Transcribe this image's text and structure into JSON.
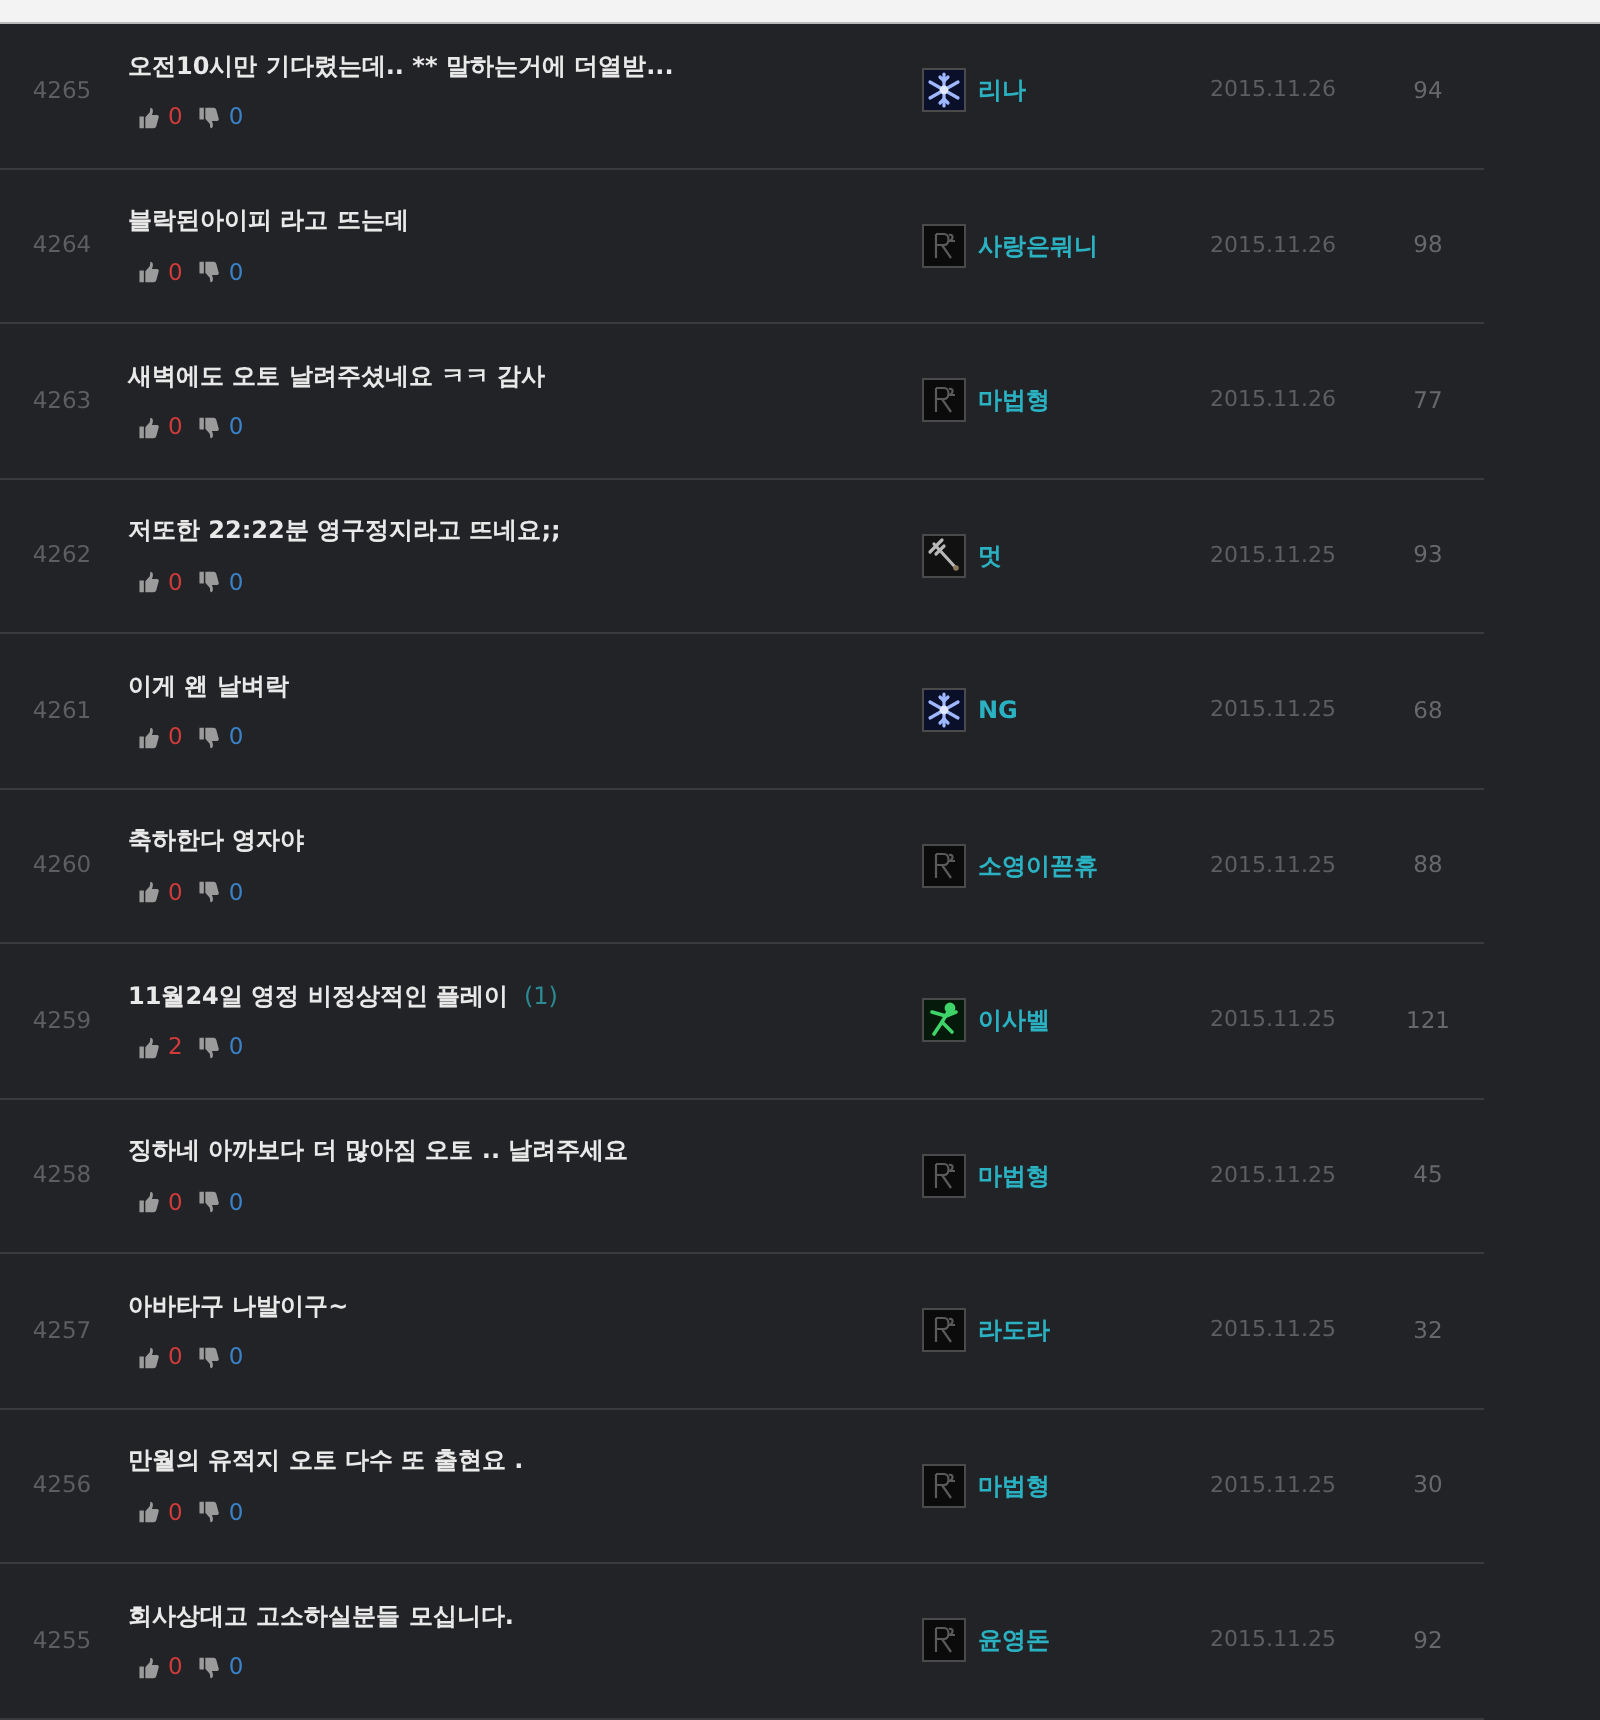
{
  "posts": [
    {
      "number": "4265",
      "title": "오전10시만 기다렸는데.. ** 말하는거에 더열받...",
      "likes": "0",
      "dislikes": "0",
      "avatar": {
        "kind": "snowflake"
      },
      "author": "리나",
      "date": "2015.11.26",
      "views": "94"
    },
    {
      "number": "4264",
      "title": "블락된아이피 라고 뜨는데",
      "likes": "0",
      "dislikes": "0",
      "avatar": {
        "kind": "emblem"
      },
      "author": "사랑은뭐니",
      "date": "2015.11.26",
      "views": "98"
    },
    {
      "number": "4263",
      "title": "새벽에도 오토 날려주셨네요 ㅋㅋ 감사",
      "likes": "0",
      "dislikes": "0",
      "avatar": {
        "kind": "emblem"
      },
      "author": "마법형",
      "date": "2015.11.26",
      "views": "77"
    },
    {
      "number": "4262",
      "title": "저또한 22:22분 영구정지라고 뜨네요;;",
      "likes": "0",
      "dislikes": "0",
      "avatar": {
        "kind": "sword"
      },
      "author": "멋",
      "date": "2015.11.25",
      "views": "93"
    },
    {
      "number": "4261",
      "title": "이게 왠 날벼락",
      "likes": "0",
      "dislikes": "0",
      "avatar": {
        "kind": "snowflake"
      },
      "author": "NG",
      "date": "2015.11.25",
      "views": "68"
    },
    {
      "number": "4260",
      "title": "축하한다 영자야",
      "likes": "0",
      "dislikes": "0",
      "avatar": {
        "kind": "emblem"
      },
      "author": "소영이꼳휴",
      "date": "2015.11.25",
      "views": "88"
    },
    {
      "number": "4259",
      "title": "11월24일 영정 비정상적인 플레이",
      "comment_count": "(1)",
      "likes": "2",
      "dislikes": "0",
      "avatar": {
        "kind": "figure"
      },
      "author": "이사벨",
      "date": "2015.11.25",
      "views": "121"
    },
    {
      "number": "4258",
      "title": "징하네 아까보다 더 많아짐 오토 .. 날려주세요",
      "likes": "0",
      "dislikes": "0",
      "avatar": {
        "kind": "emblem"
      },
      "author": "마법형",
      "date": "2015.11.25",
      "views": "45"
    },
    {
      "number": "4257",
      "title": "아바타구 나발이구~",
      "likes": "0",
      "dislikes": "0",
      "avatar": {
        "kind": "emblem"
      },
      "author": "라도라",
      "date": "2015.11.25",
      "views": "32"
    },
    {
      "number": "4256",
      "title": "만월의 유적지 오토 다수 또 출현요 .",
      "likes": "0",
      "dislikes": "0",
      "avatar": {
        "kind": "emblem"
      },
      "author": "마법형",
      "date": "2015.11.25",
      "views": "30"
    },
    {
      "number": "4255",
      "title": "회사상대고 고소하실분들 모십니다.",
      "likes": "0",
      "dislikes": "0",
      "avatar": {
        "kind": "emblem"
      },
      "author": "윤영돈",
      "date": "2015.11.25",
      "views": "92"
    }
  ]
}
